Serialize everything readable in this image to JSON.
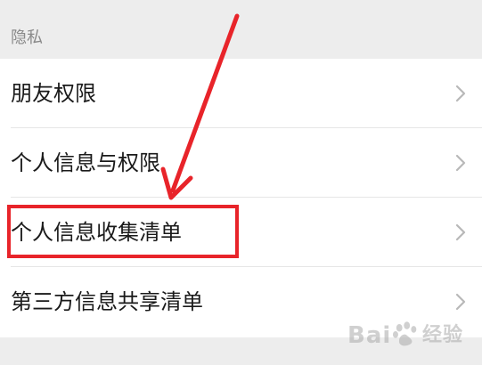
{
  "section": {
    "title": "隐私"
  },
  "rows": [
    {
      "label": "朋友权限"
    },
    {
      "label": "个人信息与权限"
    },
    {
      "label": "个人信息收集清单"
    },
    {
      "label": "第三方信息共享清单"
    }
  ],
  "annotation": {
    "box_color": "#e8242a",
    "arrow_color": "#e8242a"
  },
  "watermark": {
    "brand_left": "Bai",
    "brand_right": "经验"
  }
}
